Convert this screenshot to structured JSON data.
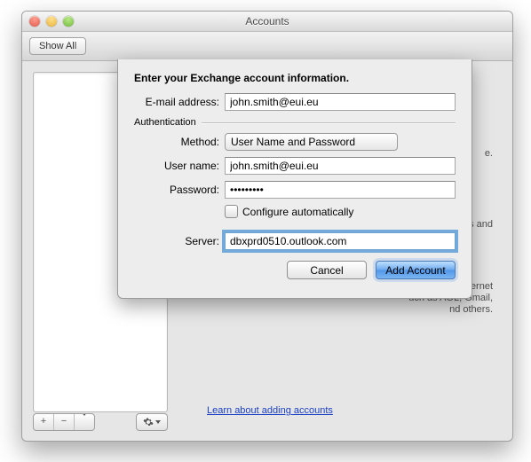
{
  "window": {
    "title": "Accounts",
    "show_all": "Show All"
  },
  "sidebar": {
    "add_glyph": "+",
    "remove_glyph": "−"
  },
  "background": {
    "line1": "e.",
    "line2": "orporations and",
    "line3a": "from Internet",
    "line3b": "uch as AOL, Gmail,",
    "line3c": "nd others.",
    "learn_link": "Learn about adding accounts"
  },
  "sheet": {
    "title": "Enter your Exchange account information.",
    "email_label": "E-mail address:",
    "email_value": "john.smith@eui.eu",
    "auth_label": "Authentication",
    "method_label": "Method:",
    "method_value": "User Name and Password",
    "username_label": "User name:",
    "username_value": "john.smith@eui.eu",
    "password_label": "Password:",
    "password_value": "•••••••••",
    "configure_auto": "Configure automatically",
    "server_label": "Server:",
    "server_value": "dbxprd0510.outlook.com",
    "cancel": "Cancel",
    "add": "Add Account"
  }
}
